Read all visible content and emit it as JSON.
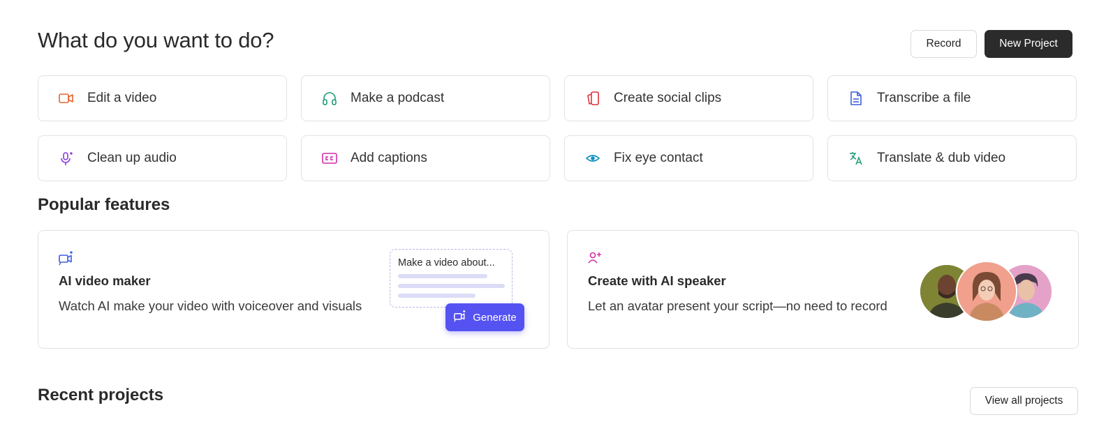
{
  "header": {
    "title": "What do you want to do?",
    "record_label": "Record",
    "new_project_label": "New Project"
  },
  "actions": [
    {
      "label": "Edit a video",
      "icon": "video-camera-icon",
      "color": "#e8632b"
    },
    {
      "label": "Make a podcast",
      "icon": "headphones-icon",
      "color": "#1b9b74"
    },
    {
      "label": "Create social clips",
      "icon": "social-clips-icon",
      "color": "#e0313c"
    },
    {
      "label": "Transcribe a file",
      "icon": "document-icon",
      "color": "#3d5fe0"
    },
    {
      "label": "Clean up audio",
      "icon": "microphone-sparkle-icon",
      "color": "#8a3be0"
    },
    {
      "label": "Add captions",
      "icon": "captions-icon",
      "color": "#d12fa6"
    },
    {
      "label": "Fix eye contact",
      "icon": "eye-icon",
      "color": "#0e8fc2"
    },
    {
      "label": "Translate & dub video",
      "icon": "translate-icon",
      "color": "#1b9b74"
    }
  ],
  "popular": {
    "title": "Popular features",
    "cards": [
      {
        "title": "AI video maker",
        "description": "Watch AI make your video with voiceover and visuals",
        "icon": "ai-video-icon",
        "prompt_text": "Make a video about...",
        "generate_label": "Generate"
      },
      {
        "title": "Create with AI speaker",
        "description": "Let an avatar present your script—no need to record",
        "icon": "ai-speaker-icon"
      }
    ]
  },
  "recent": {
    "title": "Recent projects",
    "view_all_label": "View all projects"
  },
  "colors": {
    "primary_dark": "#2b2b2b",
    "generate": "#5552f2",
    "ai_video_icon": "#3d5fe0",
    "ai_speaker_icon": "#d12fa6"
  }
}
